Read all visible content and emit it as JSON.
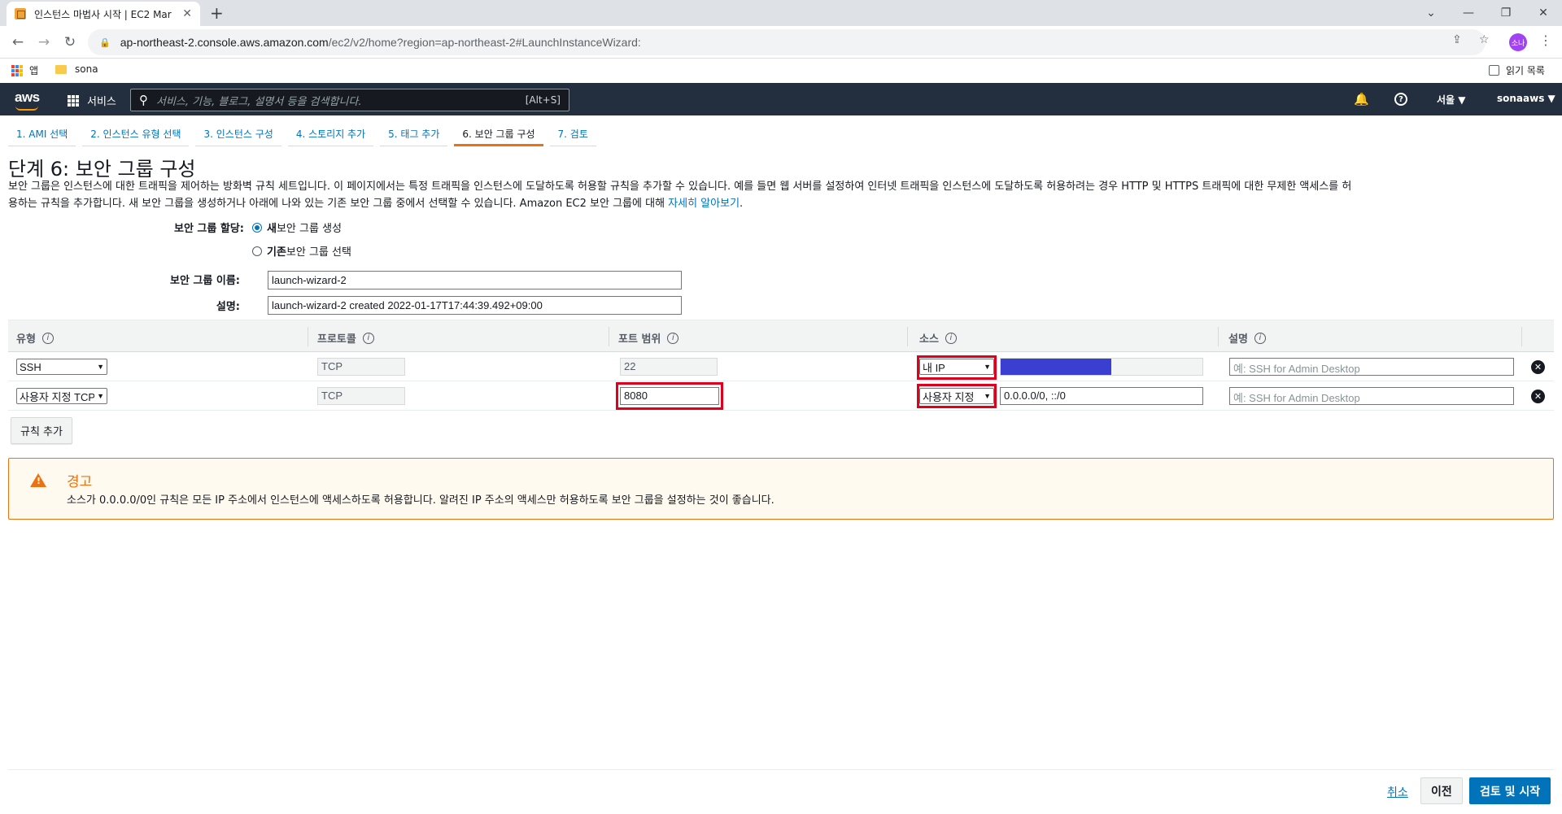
{
  "browser": {
    "tab_title": "인스턴스 마법사 시작 | EC2 Mar",
    "tab_close": "✕",
    "new_tab": "+",
    "url_host": "ap-northeast-2.console.aws.amazon.com",
    "url_path": "/ec2/v2/home?region=ap-northeast-2#LaunchInstanceWizard:",
    "profile_initials": "소나",
    "bookmarks": {
      "apps": "앱",
      "folder": "sona",
      "reading_list": "읽기 목록"
    }
  },
  "aws_header": {
    "logo": "aws",
    "services": "서비스",
    "search_placeholder": "서비스, 기능, 블로그, 설명서 등을 검색합니다.",
    "search_shortcut": "[Alt+S]",
    "region": "서울 ▼",
    "account": "sonaaws ▼"
  },
  "wizard_tabs": [
    {
      "label": "1. AMI 선택",
      "active": false
    },
    {
      "label": "2. 인스턴스 유형 선택",
      "active": false
    },
    {
      "label": "3. 인스턴스 구성",
      "active": false
    },
    {
      "label": "4. 스토리지 추가",
      "active": false
    },
    {
      "label": "5. 태그 추가",
      "active": false
    },
    {
      "label": "6. 보안 그룹 구성",
      "active": true
    },
    {
      "label": "7. 검토",
      "active": false
    }
  ],
  "page": {
    "title": "단계 6: 보안 그룹 구성",
    "description_line1": "보안 그룹은 인스턴스에 대한 트래픽을 제어하는 방화벽 규칙 세트입니다. 이 페이지에서는 특정 트래픽을 인스턴스에 도달하도록 허용할 규칙을 추가할 수 있습니다. 예를 들면 웹 서버를 설정하여 인터넷 트래픽을 인스턴스에 도달하도록 허용하려는 경우 HTTP 및 HTTPS 트래픽에 대한 무제한 액세스를 허",
    "description_line2": "용하는 규칙을 추가합니다. 새 보안 그룹을 생성하거나 아래에 나와 있는 기존 보안 그룹 중에서 선택할 수 있습니다. Amazon EC2 보안 그룹에 대해 ",
    "learn_more": "자세히 알아보기",
    "description_end": "."
  },
  "form": {
    "assign_label": "보안 그룹 할당:",
    "option_new_bold": "새",
    "option_new_rest": " 보안 그룹 생성",
    "option_existing_bold": "기존",
    "option_existing_rest": " 보안 그룹 선택",
    "name_label": "보안 그룹 이름:",
    "name_value": "launch-wizard-2",
    "desc_label": "설명:",
    "desc_value": "launch-wizard-2 created 2022-01-17T17:44:39.492+09:00"
  },
  "rules_table": {
    "headers": [
      "유형",
      "프로토콜",
      "포트 범위",
      "소스",
      "설명"
    ],
    "info_glyph": "i",
    "rows": [
      {
        "type": "SSH",
        "protocol": "TCP",
        "port": "22",
        "source_type": "내 IP",
        "source_value": "",
        "description_placeholder": "예: SSH for Admin Desktop"
      },
      {
        "type": "사용자 지정 TCP",
        "protocol": "TCP",
        "port": "8080",
        "source_type": "사용자 지정",
        "source_value": "0.0.0.0/0, ::/0",
        "description_placeholder": "예: SSH for Admin Desktop"
      }
    ],
    "my_ip_fill": 0.55,
    "remove_glyph": "✕"
  },
  "add_rule": "규칙 추가",
  "warning": {
    "icon": "!",
    "title": "경고",
    "text": "소스가 0.0.0.0/0인 규칙은 모든 IP 주소에서 인스턴스에 액세스하도록 허용합니다. 알려진 IP 주소의 액세스만 허용하도록 보안 그룹을 설정하는 것이 좋습니다."
  },
  "footer": {
    "cancel": "취소",
    "previous": "이전",
    "review_launch": "검토 및 시작"
  },
  "colors": {
    "aws_nav": "#232f3e",
    "link": "#0073bb",
    "warning": "#ec7211",
    "highlight": "#e0001b",
    "my_ip_fill": "#3a3ed1"
  }
}
